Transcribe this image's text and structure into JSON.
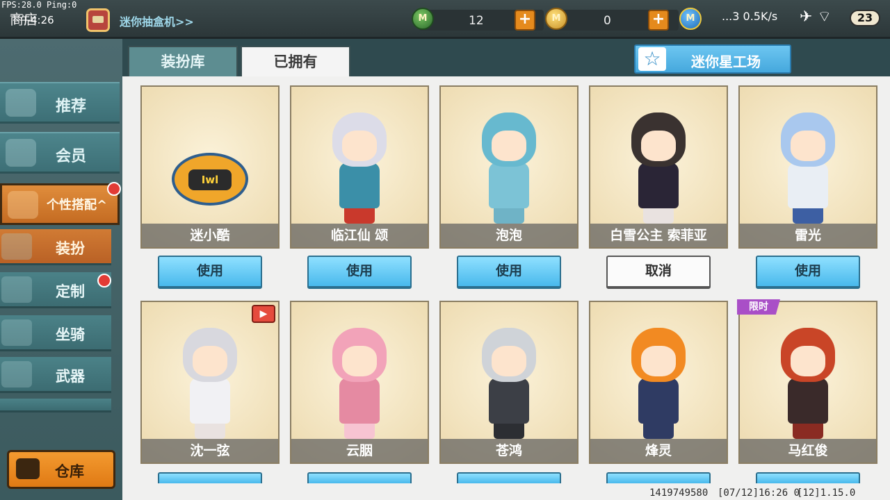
{
  "status": {
    "fps": "FPS:28.0 Ping:0",
    "time": "下午4:26",
    "network": "...3 0.5K/s",
    "battery": "23"
  },
  "topbar": {
    "back_label": "商店",
    "gacha_link": "迷你抽盒机>>",
    "currencies": [
      {
        "name": "mini-bean",
        "value": "12"
      },
      {
        "name": "mini-coin",
        "value": "0"
      }
    ],
    "plus": "+",
    "coin_letter": "M"
  },
  "tabs": {
    "wardrobe": "装扮库",
    "owned": "已拥有"
  },
  "workshop": {
    "label": "迷你星工场",
    "icon": "☆"
  },
  "sidebar": {
    "recommend": "推荐",
    "member": "会员",
    "personal_outfit": "个性搭配^",
    "outfit": "装扮",
    "custom": "定制",
    "mount": "坐骑",
    "weapon": "武器",
    "warehouse": "仓库"
  },
  "cards": [
    {
      "name": "迷小酷",
      "button": "使用"
    },
    {
      "name": "临江仙 颂",
      "button": "使用"
    },
    {
      "name": "泡泡",
      "button": "使用"
    },
    {
      "name": "白雪公主 索菲亚",
      "button": "取消"
    },
    {
      "name": "雷光",
      "button": "使用"
    },
    {
      "name": "沈一弦",
      "badge": "▶"
    },
    {
      "name": "云胭"
    },
    {
      "name": "苍鸿"
    },
    {
      "name": "烽灵"
    },
    {
      "name": "马红俊",
      "badge": "限时"
    }
  ],
  "footer": {
    "uid": "1419749580",
    "date": "[07/12]16:26 0",
    "version": "[12]1.15.0"
  }
}
